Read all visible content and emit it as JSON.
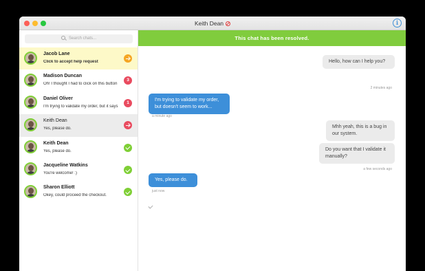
{
  "window": {
    "title": "Keith Dean",
    "title_icon": "ban-icon",
    "info_icon": "info-icon",
    "info_glyph": "i"
  },
  "sidebar": {
    "search_placeholder": "Search chats...",
    "items": [
      {
        "name": "Jacob Lane",
        "preview": "Click to accept help request",
        "status": "arrow",
        "badge_color": "#f5a623",
        "badge_text": ""
      },
      {
        "name": "Madison Duncan",
        "preview": "Oh! I thought I had to click on this button",
        "status": "count",
        "badge_color": "#e94b5f",
        "badge_text": "3"
      },
      {
        "name": "Daniel Oliver",
        "preview": "I'm trying to validate my order, but it says",
        "status": "count",
        "badge_color": "#e94b5f",
        "badge_text": "1"
      },
      {
        "name": "Keith Dean",
        "preview": "Yes, please do.",
        "status": "arrow",
        "badge_color": "#e94b5f",
        "badge_text": ""
      },
      {
        "name": "Keith Dean",
        "preview": "Yes, please do.",
        "status": "check",
        "badge_color": "#7fcf36",
        "badge_text": ""
      },
      {
        "name": "Jacqueline Watkins",
        "preview": "You're welcome! :)",
        "status": "check",
        "badge_color": "#7fcf36",
        "badge_text": ""
      },
      {
        "name": "Sharon Elliott",
        "preview": "Okey, could proceed the checkout.",
        "status": "check",
        "badge_color": "#7fcf36",
        "badge_text": ""
      }
    ]
  },
  "chat": {
    "banner": "This chat has been resolved.",
    "messages": [
      {
        "text": "Hello, how can I help you?",
        "meta": "2 minutes ago",
        "side": "out"
      },
      {
        "text": "I'm trying to validate my order, but doesn't seem to work...",
        "meta": "a minute ago",
        "side": "in"
      },
      {
        "text": "Mhh yeah, this is a bug in our system.",
        "meta": "",
        "side": "out"
      },
      {
        "text": "Do you want that I validate it manually?",
        "meta": "a few seconds ago",
        "side": "out"
      },
      {
        "text": "Yes, please do.",
        "meta": "just now",
        "side": "in"
      }
    ]
  },
  "colors": {
    "accent_green": "#80cc3d",
    "incoming_blue": "#3d8fd9",
    "highlight_yellow": "#fdf9c8"
  }
}
